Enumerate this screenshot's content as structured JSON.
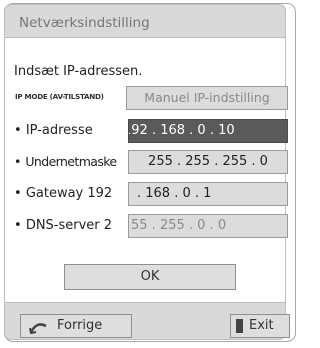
{
  "dialog": {
    "title": "Netværksindstilling",
    "prompt": "Indsæt IP-adressen.",
    "ip_mode": {
      "label": "IP MODE (AV-TILSTAND)",
      "value": "Manuel IP-indstilling"
    },
    "rows": [
      {
        "label": "IP-adresse",
        "prefix": "",
        "value": "192 . 168 . 0 . 10"
      },
      {
        "label": "Undernetmaske",
        "prefix": "",
        "value": "255 . 255 . 255 . 0"
      },
      {
        "label": "Gateway",
        "prefix": "192",
        "value": ". 168 . 0 . 1"
      },
      {
        "label": "DNS-server",
        "prefix": "2",
        "value": "55 . 255 . 0 . 0"
      }
    ],
    "ok_label": "OK",
    "back_label": "Forrige",
    "exit_label": "Exit"
  },
  "icons": {
    "back": "back-arrow-icon",
    "exit": "exit-door-icon"
  },
  "colors": {
    "selected_field": "#5a5a5a",
    "field": "#dcdcdc",
    "title_bar": "#d9d9d9"
  }
}
